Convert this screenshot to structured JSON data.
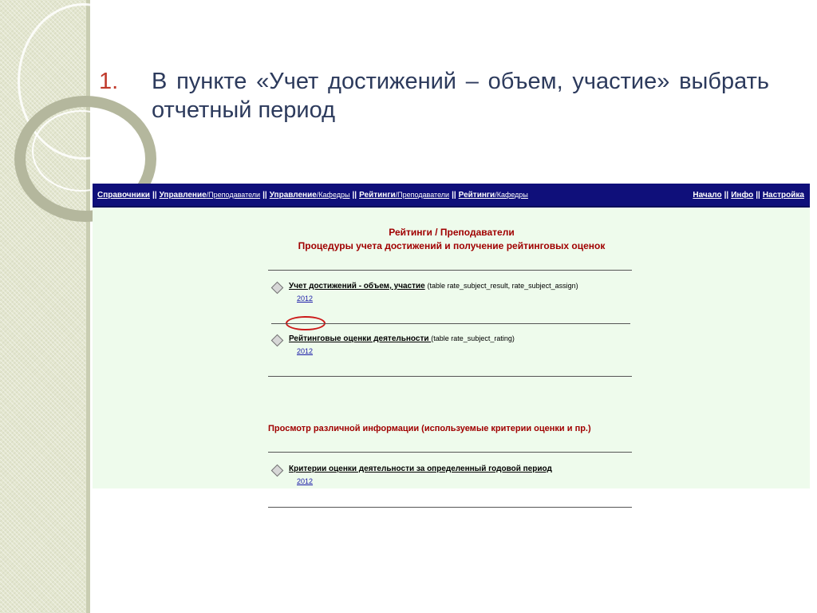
{
  "slide": {
    "step_number": "1.",
    "instruction": "В пункте «Учет достижений – объем, участие» выбрать отчетный период"
  },
  "nav": {
    "left": [
      {
        "label": "Справочники",
        "sub": ""
      },
      {
        "label": "Управление",
        "sub": "/Преподаватели"
      },
      {
        "label": "Управление",
        "sub": "/Кафедры"
      },
      {
        "label": "Рейтинги",
        "sub": "/Преподаватели"
      },
      {
        "label": "Рейтинги",
        "sub": "/Кафедры"
      }
    ],
    "separator": "||",
    "right": [
      "Начало",
      "Инфо",
      "Настройка"
    ]
  },
  "content": {
    "title_line1": "Рейтинги / Преподаватели",
    "title_line2": "Процедуры учета достижений и получение рейтинговых оценок",
    "items": [
      {
        "title": "Учет достижений - объем, участие",
        "table_note": "(table rate_subject_result, rate_subject_assign)",
        "year": "2012"
      },
      {
        "title": "Рейтинговые оценки деятельности ",
        "table_note": "(table rate_subject_rating)",
        "year": "2012"
      },
      {
        "title": "Критерии оценки деятельности за определенный годовой период",
        "table_note": "",
        "year": "2012"
      }
    ],
    "section2_title": "Просмотр различной информации (используемые критерии оценки и пр.)"
  },
  "colors": {
    "nav_bg": "#0f0f7a",
    "page_bg": "#eefbec",
    "heading_red": "#a00000",
    "link_blue": "#1a1aa8",
    "annotation_circle": "#cc1a1a"
  }
}
